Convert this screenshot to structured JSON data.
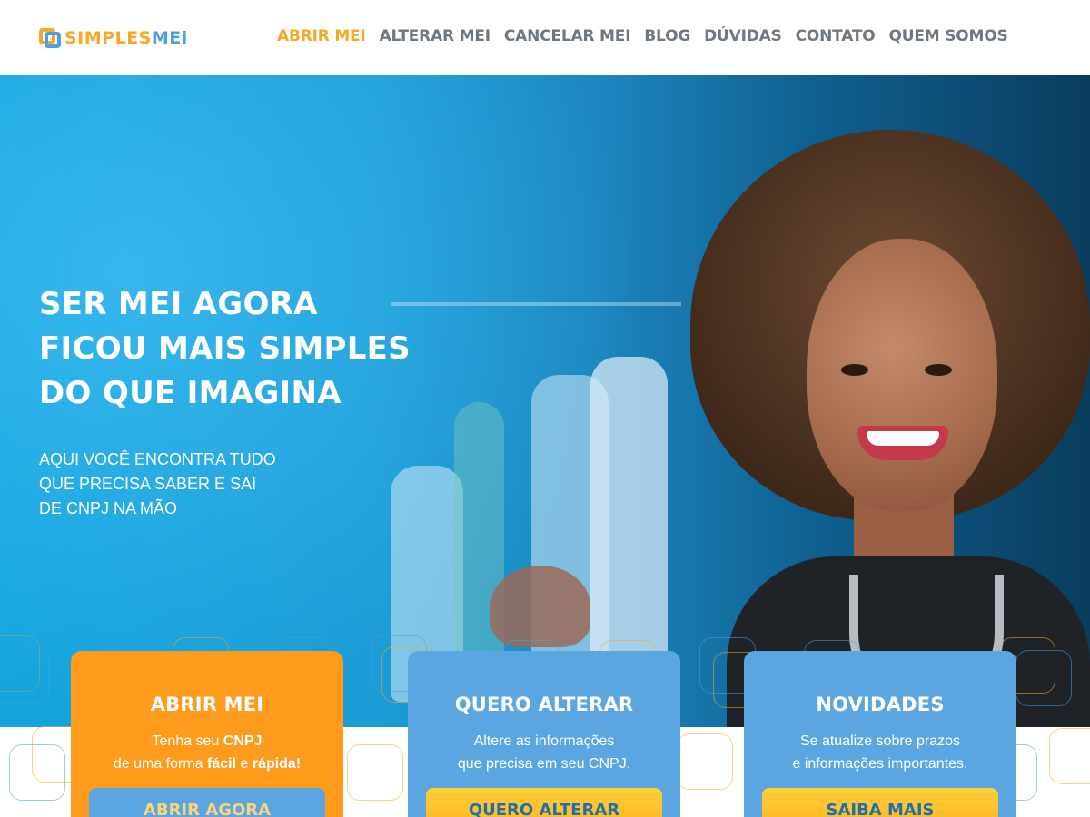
{
  "header": {
    "logo": {
      "part1": "SIMPLES",
      "part2": "MEi"
    },
    "nav": [
      {
        "label": "ABRIR MEI",
        "active": true
      },
      {
        "label": "ALTERAR MEI",
        "active": false
      },
      {
        "label": "CANCELAR MEI",
        "active": false
      },
      {
        "label": "BLOG",
        "active": false
      },
      {
        "label": "DÚVIDAS",
        "active": false
      },
      {
        "label": "CONTATO",
        "active": false
      },
      {
        "label": "QUEM SOMOS",
        "active": false
      }
    ]
  },
  "hero": {
    "title_lines": [
      "SER MEI AGORA",
      "FICOU MAIS SIMPLES",
      "DO QUE IMAGINA"
    ],
    "subtitle_lines": [
      "AQUI VOCÊ ENCONTRA TUDO",
      "QUE PRECISA SABER E SAI",
      "DE CNPJ NA MÃO"
    ]
  },
  "cards": [
    {
      "title": "ABRIR MEI",
      "line1_pre": "Tenha seu ",
      "line1_bold": "CNPJ",
      "line2_pre": "de uma forma ",
      "line2_bold1": "fácil",
      "line2_mid": " e ",
      "line2_bold2": "rápida!",
      "button": "ABRIR AGORA"
    },
    {
      "title": "QUERO ALTERAR",
      "line1": "Altere as informações",
      "line2": "que precisa em seu CNPJ.",
      "button": "QUERO ALTERAR"
    },
    {
      "title": "NOVIDADES",
      "line1": "Se atualize sobre prazos",
      "line2": "e informações importantes.",
      "button": "SAIBA MAIS"
    }
  ],
  "colors": {
    "accent_orange": "#f7a823",
    "accent_blue": "#4a9fe0",
    "card_orange": "#ff9b1c",
    "card_blue": "#5ba6e1",
    "button_yellow": "#ffc02a"
  }
}
